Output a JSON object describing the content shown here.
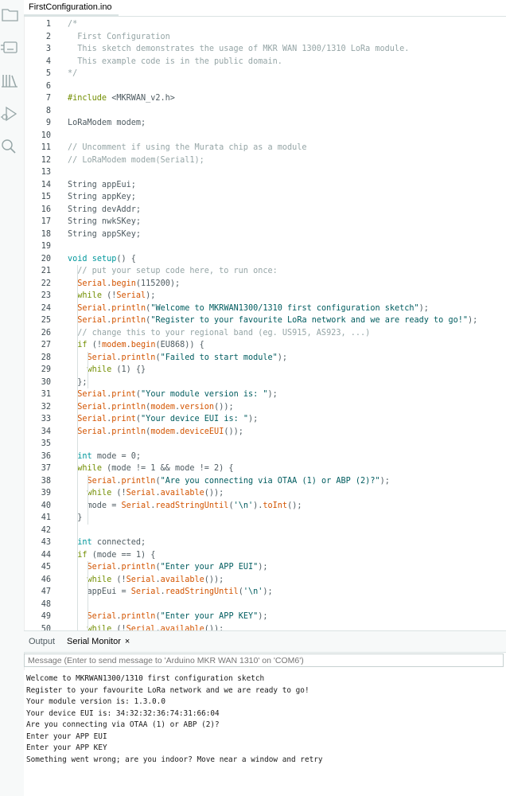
{
  "file_tab": {
    "label": "FirstConfiguration.ino"
  },
  "sidebar": {
    "icons": [
      "folder-icon",
      "board-icon",
      "library-icon",
      "debug-icon",
      "search-icon"
    ]
  },
  "code_lines": [
    {
      "n": "1",
      "tokens": [
        {
          "c": "comment",
          "t": "/*"
        }
      ]
    },
    {
      "n": "2",
      "tokens": [
        {
          "c": "comment",
          "t": "  First Configuration"
        }
      ]
    },
    {
      "n": "3",
      "tokens": [
        {
          "c": "comment",
          "t": "  This sketch demonstrates the usage of MKR WAN 1300/1310 LoRa module."
        }
      ]
    },
    {
      "n": "4",
      "tokens": [
        {
          "c": "comment",
          "t": "  This example code is in the public domain."
        }
      ]
    },
    {
      "n": "5",
      "tokens": [
        {
          "c": "comment",
          "t": "*/"
        }
      ]
    },
    {
      "n": "6",
      "tokens": []
    },
    {
      "n": "7",
      "tokens": [
        {
          "c": "pre",
          "t": "#include"
        },
        {
          "c": "plain",
          "t": " <MKRWAN_v2.h>"
        }
      ]
    },
    {
      "n": "8",
      "tokens": []
    },
    {
      "n": "9",
      "tokens": [
        {
          "c": "plain",
          "t": "LoRaModem modem;"
        }
      ]
    },
    {
      "n": "10",
      "tokens": []
    },
    {
      "n": "11",
      "tokens": [
        {
          "c": "comment",
          "t": "// Uncomment if using the Murata chip as a module"
        }
      ]
    },
    {
      "n": "12",
      "tokens": [
        {
          "c": "comment",
          "t": "// LoRaModem modem(Serial1);"
        }
      ]
    },
    {
      "n": "13",
      "tokens": []
    },
    {
      "n": "14",
      "tokens": [
        {
          "c": "plain",
          "t": "String appEui;"
        }
      ]
    },
    {
      "n": "15",
      "tokens": [
        {
          "c": "plain",
          "t": "String appKey;"
        }
      ]
    },
    {
      "n": "16",
      "tokens": [
        {
          "c": "plain",
          "t": "String devAddr;"
        }
      ]
    },
    {
      "n": "17",
      "tokens": [
        {
          "c": "plain",
          "t": "String nwkSKey;"
        }
      ]
    },
    {
      "n": "18",
      "tokens": [
        {
          "c": "plain",
          "t": "String appSKey;"
        }
      ]
    },
    {
      "n": "19",
      "tokens": []
    },
    {
      "n": "20",
      "tokens": [
        {
          "c": "type",
          "t": "void"
        },
        {
          "c": "plain",
          "t": " "
        },
        {
          "c": "type",
          "t": "setup"
        },
        {
          "c": "plain",
          "t": "() {"
        }
      ]
    },
    {
      "n": "21",
      "tokens": [
        {
          "c": "comment",
          "t": "  // put your setup code here, to run once:"
        }
      ]
    },
    {
      "n": "22",
      "tokens": [
        {
          "c": "plain",
          "t": "  "
        },
        {
          "c": "func",
          "t": "Serial"
        },
        {
          "c": "plain",
          "t": "."
        },
        {
          "c": "func",
          "t": "begin"
        },
        {
          "c": "plain",
          "t": "(115200);"
        }
      ]
    },
    {
      "n": "23",
      "tokens": [
        {
          "c": "plain",
          "t": "  "
        },
        {
          "c": "key",
          "t": "while"
        },
        {
          "c": "plain",
          "t": " (!"
        },
        {
          "c": "func",
          "t": "Serial"
        },
        {
          "c": "plain",
          "t": ");"
        }
      ]
    },
    {
      "n": "24",
      "tokens": [
        {
          "c": "plain",
          "t": "  "
        },
        {
          "c": "func",
          "t": "Serial"
        },
        {
          "c": "plain",
          "t": "."
        },
        {
          "c": "func",
          "t": "println"
        },
        {
          "c": "plain",
          "t": "("
        },
        {
          "c": "str",
          "t": "\"Welcome to MKRWAN1300/1310 first configuration sketch\""
        },
        {
          "c": "plain",
          "t": ");"
        }
      ]
    },
    {
      "n": "25",
      "tokens": [
        {
          "c": "plain",
          "t": "  "
        },
        {
          "c": "func",
          "t": "Serial"
        },
        {
          "c": "plain",
          "t": "."
        },
        {
          "c": "func",
          "t": "println"
        },
        {
          "c": "plain",
          "t": "("
        },
        {
          "c": "str",
          "t": "\"Register to your favourite LoRa network and we are ready to go!\""
        },
        {
          "c": "plain",
          "t": ");"
        }
      ]
    },
    {
      "n": "26",
      "tokens": [
        {
          "c": "comment",
          "t": "  // change this to your regional band (eg. US915, AS923, ...)"
        }
      ]
    },
    {
      "n": "27",
      "tokens": [
        {
          "c": "plain",
          "t": "  "
        },
        {
          "c": "key",
          "t": "if"
        },
        {
          "c": "plain",
          "t": " (!"
        },
        {
          "c": "func",
          "t": "modem"
        },
        {
          "c": "plain",
          "t": "."
        },
        {
          "c": "func",
          "t": "begin"
        },
        {
          "c": "plain",
          "t": "(EU868)) {"
        }
      ]
    },
    {
      "n": "28",
      "tokens": [
        {
          "c": "plain",
          "t": "    "
        },
        {
          "c": "func",
          "t": "Serial"
        },
        {
          "c": "plain",
          "t": "."
        },
        {
          "c": "func",
          "t": "println"
        },
        {
          "c": "plain",
          "t": "("
        },
        {
          "c": "str",
          "t": "\"Failed to start module\""
        },
        {
          "c": "plain",
          "t": ");"
        }
      ]
    },
    {
      "n": "29",
      "tokens": [
        {
          "c": "plain",
          "t": "    "
        },
        {
          "c": "key",
          "t": "while"
        },
        {
          "c": "plain",
          "t": " (1) {}"
        }
      ]
    },
    {
      "n": "30",
      "tokens": [
        {
          "c": "plain",
          "t": "  };"
        }
      ]
    },
    {
      "n": "31",
      "tokens": [
        {
          "c": "plain",
          "t": "  "
        },
        {
          "c": "func",
          "t": "Serial"
        },
        {
          "c": "plain",
          "t": "."
        },
        {
          "c": "func",
          "t": "print"
        },
        {
          "c": "plain",
          "t": "("
        },
        {
          "c": "str",
          "t": "\"Your module version is: \""
        },
        {
          "c": "plain",
          "t": ");"
        }
      ]
    },
    {
      "n": "32",
      "tokens": [
        {
          "c": "plain",
          "t": "  "
        },
        {
          "c": "func",
          "t": "Serial"
        },
        {
          "c": "plain",
          "t": "."
        },
        {
          "c": "func",
          "t": "println"
        },
        {
          "c": "plain",
          "t": "("
        },
        {
          "c": "func",
          "t": "modem"
        },
        {
          "c": "plain",
          "t": "."
        },
        {
          "c": "func",
          "t": "version"
        },
        {
          "c": "plain",
          "t": "());"
        }
      ]
    },
    {
      "n": "33",
      "tokens": [
        {
          "c": "plain",
          "t": "  "
        },
        {
          "c": "func",
          "t": "Serial"
        },
        {
          "c": "plain",
          "t": "."
        },
        {
          "c": "func",
          "t": "print"
        },
        {
          "c": "plain",
          "t": "("
        },
        {
          "c": "str",
          "t": "\"Your device EUI is: \""
        },
        {
          "c": "plain",
          "t": ");"
        }
      ]
    },
    {
      "n": "34",
      "tokens": [
        {
          "c": "plain",
          "t": "  "
        },
        {
          "c": "func",
          "t": "Serial"
        },
        {
          "c": "plain",
          "t": "."
        },
        {
          "c": "func",
          "t": "println"
        },
        {
          "c": "plain",
          "t": "("
        },
        {
          "c": "func",
          "t": "modem"
        },
        {
          "c": "plain",
          "t": "."
        },
        {
          "c": "func",
          "t": "deviceEUI"
        },
        {
          "c": "plain",
          "t": "());"
        }
      ]
    },
    {
      "n": "35",
      "tokens": []
    },
    {
      "n": "36",
      "tokens": [
        {
          "c": "plain",
          "t": "  "
        },
        {
          "c": "type",
          "t": "int"
        },
        {
          "c": "plain",
          "t": " mode = 0;"
        }
      ]
    },
    {
      "n": "37",
      "tokens": [
        {
          "c": "plain",
          "t": "  "
        },
        {
          "c": "key",
          "t": "while"
        },
        {
          "c": "plain",
          "t": " (mode != 1 && mode != 2) {"
        }
      ]
    },
    {
      "n": "38",
      "tokens": [
        {
          "c": "plain",
          "t": "    "
        },
        {
          "c": "func",
          "t": "Serial"
        },
        {
          "c": "plain",
          "t": "."
        },
        {
          "c": "func",
          "t": "println"
        },
        {
          "c": "plain",
          "t": "("
        },
        {
          "c": "str",
          "t": "\"Are you connecting via OTAA (1) or ABP (2)?\""
        },
        {
          "c": "plain",
          "t": ");"
        }
      ]
    },
    {
      "n": "39",
      "tokens": [
        {
          "c": "plain",
          "t": "    "
        },
        {
          "c": "key",
          "t": "while"
        },
        {
          "c": "plain",
          "t": " (!"
        },
        {
          "c": "func",
          "t": "Serial"
        },
        {
          "c": "plain",
          "t": "."
        },
        {
          "c": "func",
          "t": "available"
        },
        {
          "c": "plain",
          "t": "());"
        }
      ]
    },
    {
      "n": "40",
      "tokens": [
        {
          "c": "plain",
          "t": "    mode = "
        },
        {
          "c": "func",
          "t": "Serial"
        },
        {
          "c": "plain",
          "t": "."
        },
        {
          "c": "func",
          "t": "readStringUntil"
        },
        {
          "c": "plain",
          "t": "("
        },
        {
          "c": "str",
          "t": "'\\n'"
        },
        {
          "c": "plain",
          "t": ")."
        },
        {
          "c": "func",
          "t": "toInt"
        },
        {
          "c": "plain",
          "t": "();"
        }
      ]
    },
    {
      "n": "41",
      "tokens": [
        {
          "c": "plain",
          "t": "  }"
        }
      ]
    },
    {
      "n": "42",
      "tokens": []
    },
    {
      "n": "43",
      "tokens": [
        {
          "c": "plain",
          "t": "  "
        },
        {
          "c": "type",
          "t": "int"
        },
        {
          "c": "plain",
          "t": " connected;"
        }
      ]
    },
    {
      "n": "44",
      "tokens": [
        {
          "c": "plain",
          "t": "  "
        },
        {
          "c": "key",
          "t": "if"
        },
        {
          "c": "plain",
          "t": " (mode == 1) {"
        }
      ]
    },
    {
      "n": "45",
      "tokens": [
        {
          "c": "plain",
          "t": "    "
        },
        {
          "c": "func",
          "t": "Serial"
        },
        {
          "c": "plain",
          "t": "."
        },
        {
          "c": "func",
          "t": "println"
        },
        {
          "c": "plain",
          "t": "("
        },
        {
          "c": "str",
          "t": "\"Enter your APP EUI\""
        },
        {
          "c": "plain",
          "t": ");"
        }
      ]
    },
    {
      "n": "46",
      "tokens": [
        {
          "c": "plain",
          "t": "    "
        },
        {
          "c": "key",
          "t": "while"
        },
        {
          "c": "plain",
          "t": " (!"
        },
        {
          "c": "func",
          "t": "Serial"
        },
        {
          "c": "plain",
          "t": "."
        },
        {
          "c": "func",
          "t": "available"
        },
        {
          "c": "plain",
          "t": "());"
        }
      ]
    },
    {
      "n": "47",
      "tokens": [
        {
          "c": "plain",
          "t": "    appEui = "
        },
        {
          "c": "func",
          "t": "Serial"
        },
        {
          "c": "plain",
          "t": "."
        },
        {
          "c": "func",
          "t": "readStringUntil"
        },
        {
          "c": "plain",
          "t": "("
        },
        {
          "c": "str",
          "t": "'\\n'"
        },
        {
          "c": "plain",
          "t": ");"
        }
      ]
    },
    {
      "n": "48",
      "tokens": []
    },
    {
      "n": "49",
      "tokens": [
        {
          "c": "plain",
          "t": "    "
        },
        {
          "c": "func",
          "t": "Serial"
        },
        {
          "c": "plain",
          "t": "."
        },
        {
          "c": "func",
          "t": "println"
        },
        {
          "c": "plain",
          "t": "("
        },
        {
          "c": "str",
          "t": "\"Enter your APP KEY\""
        },
        {
          "c": "plain",
          "t": ");"
        }
      ]
    },
    {
      "n": "50",
      "tokens": [
        {
          "c": "plain",
          "t": "    "
        },
        {
          "c": "key",
          "t": "while"
        },
        {
          "c": "plain",
          "t": " (!"
        },
        {
          "c": "func",
          "t": "Serial"
        },
        {
          "c": "plain",
          "t": "."
        },
        {
          "c": "func",
          "t": "available"
        },
        {
          "c": "plain",
          "t": "());"
        }
      ]
    }
  ],
  "bottom_panel": {
    "tabs": [
      {
        "label": "Output",
        "active": false
      },
      {
        "label": "Serial Monitor",
        "active": true,
        "close": "×"
      }
    ],
    "message_placeholder": "Message (Enter to send message to 'Arduino MKR WAN 1310' on 'COM6')",
    "serial_output": [
      "Welcome to MKRWAN1300/1310 first configuration sketch",
      "Register to your favourite LoRa network and we are ready to go!",
      "Your module version is: 1.3.0.0",
      "Your device EUI is: 34:32:32:36:74:31:66:04",
      "Are you connecting via OTAA (1) or ABP (2)?",
      "Enter your APP EUI",
      "Enter your APP KEY",
      "Something went wrong; are you indoor? Move near a window and retry"
    ]
  }
}
